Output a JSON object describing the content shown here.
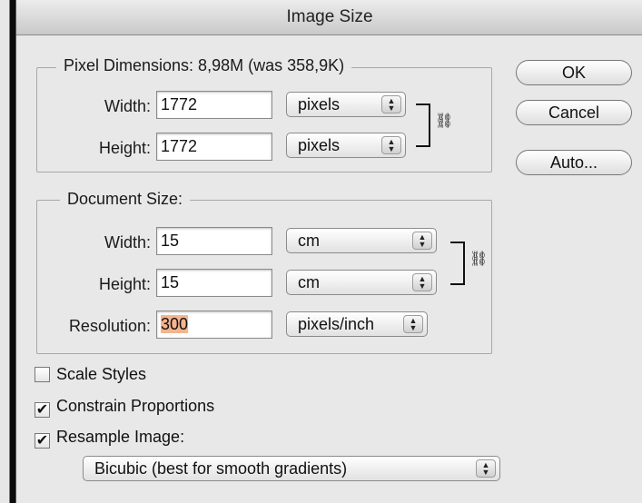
{
  "window": {
    "title": "Image Size"
  },
  "pixel_dimensions": {
    "legend": "Pixel Dimensions:  8,98M (was 358,9K)",
    "width": {
      "label": "Width:",
      "value": "1772",
      "unit": "pixels"
    },
    "height": {
      "label": "Height:",
      "value": "1772",
      "unit": "pixels"
    }
  },
  "document_size": {
    "legend": "Document Size:",
    "width": {
      "label": "Width:",
      "value": "15",
      "unit": "cm"
    },
    "height": {
      "label": "Height:",
      "value": "15",
      "unit": "cm"
    },
    "resolution": {
      "label": "Resolution:",
      "value": "300",
      "unit": "pixels/inch"
    }
  },
  "options": {
    "scale_styles": {
      "label": "Scale Styles",
      "checked": false
    },
    "constrain_proportions": {
      "label": "Constrain Proportions",
      "checked": true
    },
    "resample_image": {
      "label": "Resample Image:",
      "checked": true
    },
    "resample_method": "Bicubic (best for smooth gradients)"
  },
  "buttons": {
    "ok": "OK",
    "cancel": "Cancel",
    "auto": "Auto..."
  },
  "icons": {
    "chain": "chain-link-icon",
    "select_arrows": "up-down-arrows-icon",
    "check": "checkmark-icon"
  }
}
